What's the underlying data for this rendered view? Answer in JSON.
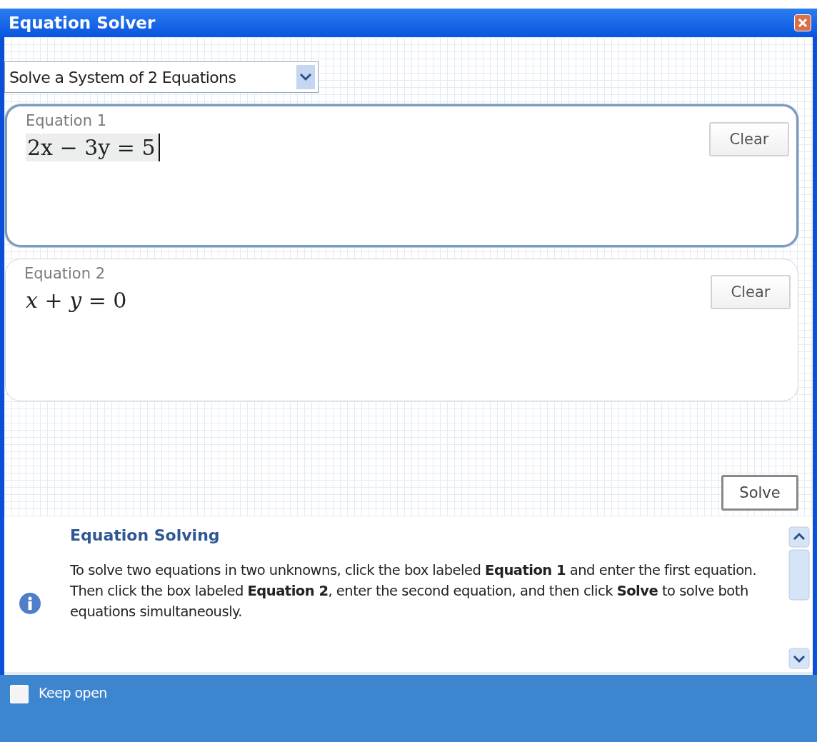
{
  "window": {
    "title": "Equation Solver"
  },
  "mode_select": {
    "value": "Solve a System of 2 Equations"
  },
  "equations": [
    {
      "label": "Equation 1",
      "value": "2x − 3y = 5",
      "focused": true,
      "clear_button": "Clear"
    },
    {
      "label": "Equation 2",
      "value": "*x* + *y* = 0",
      "focused": false,
      "clear_button": "Clear"
    }
  ],
  "solve_button": "Solve",
  "help": {
    "title": "Equation Solving",
    "text": "To solve two equations in two unknowns, click the box labeled **Equation 1** and enter the first equation. Then click the box labeled **Equation 2**, enter the second equation, and then click **Solve**  to solve both equations simultaneously."
  },
  "footer": {
    "checkbox": {
      "label": "Keep open",
      "checked": false
    }
  }
}
